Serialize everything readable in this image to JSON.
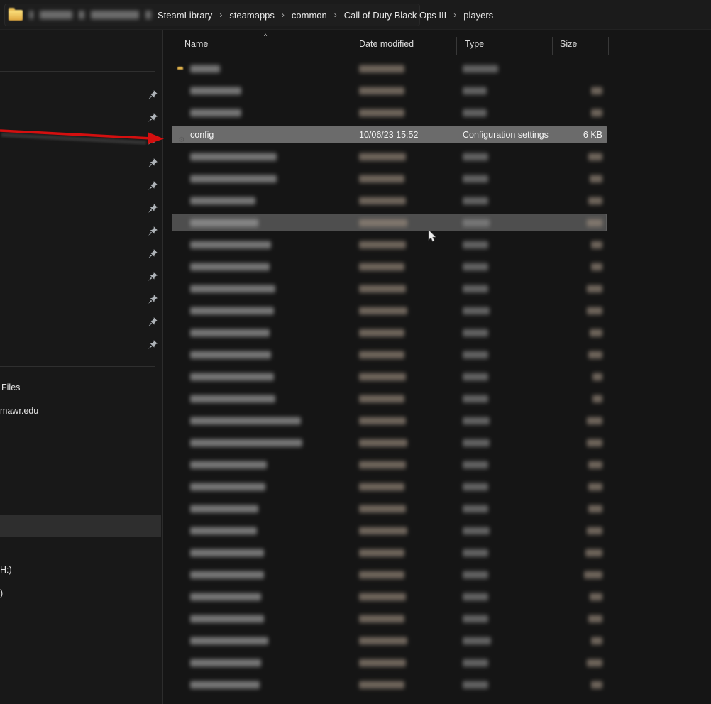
{
  "breadcrumb": {
    "separator": "›",
    "redacted_segments": [
      {
        "w": 6
      },
      {
        "w": 46
      },
      {
        "w": 8
      },
      {
        "w": 68
      },
      {
        "w": 8
      }
    ],
    "segments": [
      "SteamLibrary",
      "steamapps",
      "common",
      "Call of Duty Black Ops III",
      "players"
    ]
  },
  "columns": {
    "name": "Name",
    "date": "Date modified",
    "type": "Type",
    "size": "Size",
    "sort_indicator": "^"
  },
  "selected_row": {
    "name": "config",
    "date": "10/06/23 15:52",
    "type": "Configuration settings",
    "size": "6 KB"
  },
  "sidebar": {
    "pin_centers_y": [
      133,
      165,
      197,
      229,
      261,
      293,
      325,
      357,
      389,
      421,
      453,
      485
    ],
    "files_label": "Files",
    "domain_label": "mawr.edu",
    "drive1_label": "H:)",
    "drive2_label": ")"
  },
  "rows": [
    {
      "kind": "folder",
      "state": "none",
      "name_w": 42,
      "date_w": 64,
      "type_w": 50,
      "size_w": 0
    },
    {
      "kind": "file",
      "state": "none",
      "name_w": 72,
      "date_w": 64,
      "type_w": 34,
      "size_w": 16
    },
    {
      "kind": "file",
      "state": "none",
      "name_w": 72,
      "date_w": 64,
      "type_w": 34,
      "size_w": 16
    },
    {
      "kind": "config",
      "state": "selected"
    },
    {
      "kind": "file",
      "state": "none",
      "name_w": 122,
      "date_w": 66,
      "type_w": 36,
      "size_w": 20
    },
    {
      "kind": "file",
      "state": "none",
      "name_w": 122,
      "date_w": 64,
      "type_w": 36,
      "size_w": 18
    },
    {
      "kind": "file",
      "state": "none",
      "name_w": 92,
      "date_w": 66,
      "type_w": 36,
      "size_w": 20
    },
    {
      "kind": "file",
      "state": "hover",
      "name_w": 96,
      "date_w": 68,
      "type_w": 38,
      "size_w": 22
    },
    {
      "kind": "file",
      "state": "none",
      "name_w": 114,
      "date_w": 66,
      "type_w": 36,
      "size_w": 16
    },
    {
      "kind": "file",
      "state": "none",
      "name_w": 112,
      "date_w": 64,
      "type_w": 36,
      "size_w": 16
    },
    {
      "kind": "file",
      "state": "none",
      "name_w": 120,
      "date_w": 66,
      "type_w": 36,
      "size_w": 22
    },
    {
      "kind": "file",
      "state": "none",
      "name_w": 118,
      "date_w": 68,
      "type_w": 38,
      "size_w": 22
    },
    {
      "kind": "file",
      "state": "none",
      "name_w": 112,
      "date_w": 64,
      "type_w": 36,
      "size_w": 18
    },
    {
      "kind": "file",
      "state": "none",
      "name_w": 114,
      "date_w": 64,
      "type_w": 36,
      "size_w": 20
    },
    {
      "kind": "file",
      "state": "none",
      "name_w": 118,
      "date_w": 66,
      "type_w": 36,
      "size_w": 14
    },
    {
      "kind": "file",
      "state": "none",
      "name_w": 120,
      "date_w": 64,
      "type_w": 36,
      "size_w": 14
    },
    {
      "kind": "file",
      "state": "none",
      "name_w": 156,
      "date_w": 66,
      "type_w": 38,
      "size_w": 22
    },
    {
      "kind": "file",
      "state": "none",
      "name_w": 158,
      "date_w": 68,
      "type_w": 38,
      "size_w": 22
    },
    {
      "kind": "file",
      "state": "none",
      "name_w": 108,
      "date_w": 66,
      "type_w": 36,
      "size_w": 20
    },
    {
      "kind": "file",
      "state": "none",
      "name_w": 106,
      "date_w": 64,
      "type_w": 36,
      "size_w": 20
    },
    {
      "kind": "file",
      "state": "none",
      "name_w": 96,
      "date_w": 66,
      "type_w": 36,
      "size_w": 20
    },
    {
      "kind": "file",
      "state": "none",
      "name_w": 94,
      "date_w": 68,
      "type_w": 38,
      "size_w": 22
    },
    {
      "kind": "file",
      "state": "none",
      "name_w": 104,
      "date_w": 64,
      "type_w": 36,
      "size_w": 24
    },
    {
      "kind": "file",
      "state": "none",
      "name_w": 104,
      "date_w": 64,
      "type_w": 36,
      "size_w": 26
    },
    {
      "kind": "file",
      "state": "none",
      "name_w": 100,
      "date_w": 66,
      "type_w": 36,
      "size_w": 18
    },
    {
      "kind": "file",
      "state": "none",
      "name_w": 104,
      "date_w": 64,
      "type_w": 36,
      "size_w": 20
    },
    {
      "kind": "file",
      "state": "none",
      "name_w": 110,
      "date_w": 68,
      "type_w": 40,
      "size_w": 16
    },
    {
      "kind": "file",
      "state": "none",
      "name_w": 100,
      "date_w": 66,
      "type_w": 36,
      "size_w": 22
    },
    {
      "kind": "file",
      "state": "none",
      "name_w": 98,
      "date_w": 64,
      "type_w": 36,
      "size_w": 16
    }
  ],
  "colors": {
    "topbar_bg": "#1b1b1b",
    "nav_bg": "#181818",
    "list_bg": "#151515",
    "selected_row_bg": "#6b6b6b",
    "hover_row_bg": "#4e4e4e",
    "nav_hover_bg": "#2e2e2e",
    "folder_yellow": "#e0a73f",
    "pin_gray": "#aeb3b8",
    "arrow_red": "#d40f0f",
    "text": "#e6e6e6"
  },
  "annotation": {
    "type": "arrow",
    "color": "#d40f0f",
    "points_to": "config row pin area"
  }
}
